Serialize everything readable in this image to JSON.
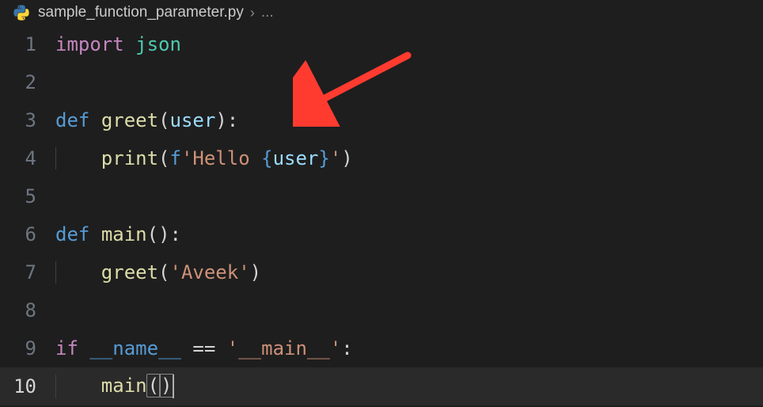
{
  "breadcrumb": {
    "filename": "sample_function_parameter.py",
    "separator": "›",
    "dots": "..."
  },
  "code": {
    "line1": {
      "num": "1",
      "import_kw": "import",
      "module": "json"
    },
    "line2": {
      "num": "2"
    },
    "line3": {
      "num": "3",
      "def_kw": "def",
      "func_name": "greet",
      "lparen": "(",
      "param": "user",
      "rparen": ")",
      "colon": ":"
    },
    "line4": {
      "num": "4",
      "builtin": "print",
      "lparen": "(",
      "fprefix": "f",
      "q1": "'",
      "str1": "Hello ",
      "lbrace": "{",
      "var": "user",
      "rbrace": "}",
      "q2": "'",
      "rparen": ")"
    },
    "line5": {
      "num": "5"
    },
    "line6": {
      "num": "6",
      "def_kw": "def",
      "func_name": "main",
      "lparen": "(",
      "rparen": ")",
      "colon": ":"
    },
    "line7": {
      "num": "7",
      "func_call": "greet",
      "lparen": "(",
      "q1": "'",
      "str": "Aveek",
      "q2": "'",
      "rparen": ")"
    },
    "line8": {
      "num": "8"
    },
    "line9": {
      "num": "9",
      "if_kw": "if",
      "dunder": "__name__",
      "eq": "==",
      "q1": "'",
      "str": "__main__",
      "q2": "'",
      "colon": ":"
    },
    "line10": {
      "num": "10",
      "func_call": "main",
      "lparen": "(",
      "rparen": ")"
    }
  }
}
